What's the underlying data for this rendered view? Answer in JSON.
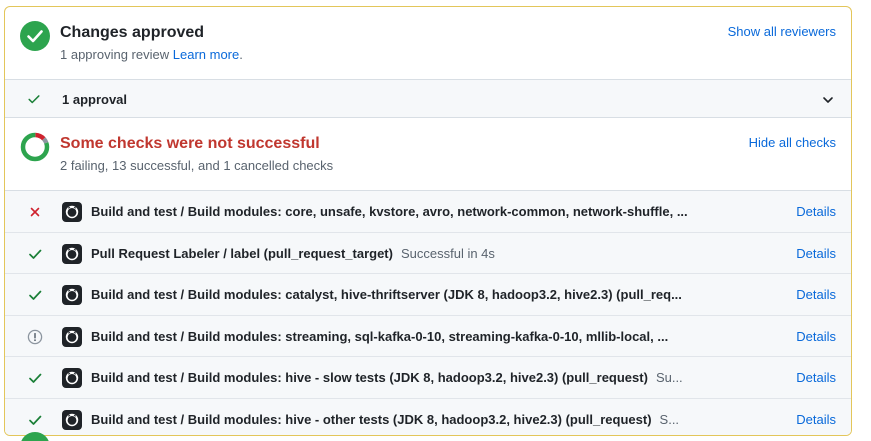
{
  "review": {
    "title": "Changes approved",
    "subtitle": "1 approving review",
    "learn_more": "Learn more",
    "subtitle_end": ".",
    "show_all": "Show all reviewers",
    "approval_label": "1 approval"
  },
  "checks": {
    "title": "Some checks were not successful",
    "subtitle": "2 failing, 13 successful, and 1 cancelled checks",
    "hide_all": "Hide all checks",
    "summary": {
      "failing": 2,
      "successful": 13,
      "cancelled": 1
    },
    "details_label": "Details",
    "rows": [
      {
        "status": "failure",
        "name": "Build and test / Build modules: core, unsafe, kvstore, avro, network-common, network-shuffle, ...",
        "desc": ""
      },
      {
        "status": "success",
        "name": "Pull Request Labeler / label (pull_request_target)",
        "desc": "Successful in 4s"
      },
      {
        "status": "success",
        "name": "Build and test / Build modules: catalyst, hive-thriftserver (JDK 8, hadoop3.2, hive2.3) (pull_req...",
        "desc": ""
      },
      {
        "status": "cancelled",
        "name": "Build and test / Build modules: streaming, sql-kafka-0-10, streaming-kafka-0-10, mllib-local, ...",
        "desc": ""
      },
      {
        "status": "success",
        "name": "Build and test / Build modules: hive - slow tests (JDK 8, hadoop3.2, hive2.3) (pull_request)",
        "desc": "Su..."
      },
      {
        "status": "success",
        "name": "Build and test / Build modules: hive - other tests (JDK 8, hadoop3.2, hive2.3) (pull_request)",
        "desc": "S..."
      }
    ]
  },
  "colors": {
    "success": "#1a7f37",
    "failure": "#cf222e",
    "neutral": "#59636e",
    "link": "#0969da",
    "border_attention": "#e3c65a"
  }
}
